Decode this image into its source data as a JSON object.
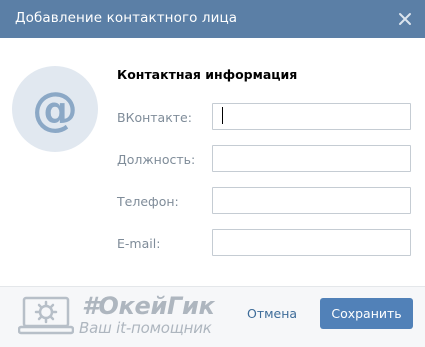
{
  "dialog": {
    "title": "Добавление контактного лица",
    "close_icon": "close-icon"
  },
  "avatar": {
    "glyph": "@",
    "icon": "at-sign-icon"
  },
  "form": {
    "section_title": "Контактная информация",
    "fields": [
      {
        "label": "ВКонтакте:",
        "value": "",
        "focused": true
      },
      {
        "label": "Должность:",
        "value": ""
      },
      {
        "label": "Телефон:",
        "value": ""
      },
      {
        "label": "E-mail:",
        "value": ""
      }
    ]
  },
  "footer": {
    "cancel_label": "Отмена",
    "save_label": "Сохранить"
  },
  "watermark": {
    "logo_text": "#ОкейГик",
    "slogan": "Ваш it-помощник",
    "icon": "laptop-gear-icon"
  },
  "colors": {
    "header": "#5b7fa6",
    "primary_button": "#5181b8",
    "link": "#3e6c99",
    "label": "#7f8c99",
    "avatar_bg": "#e1e8f0"
  }
}
